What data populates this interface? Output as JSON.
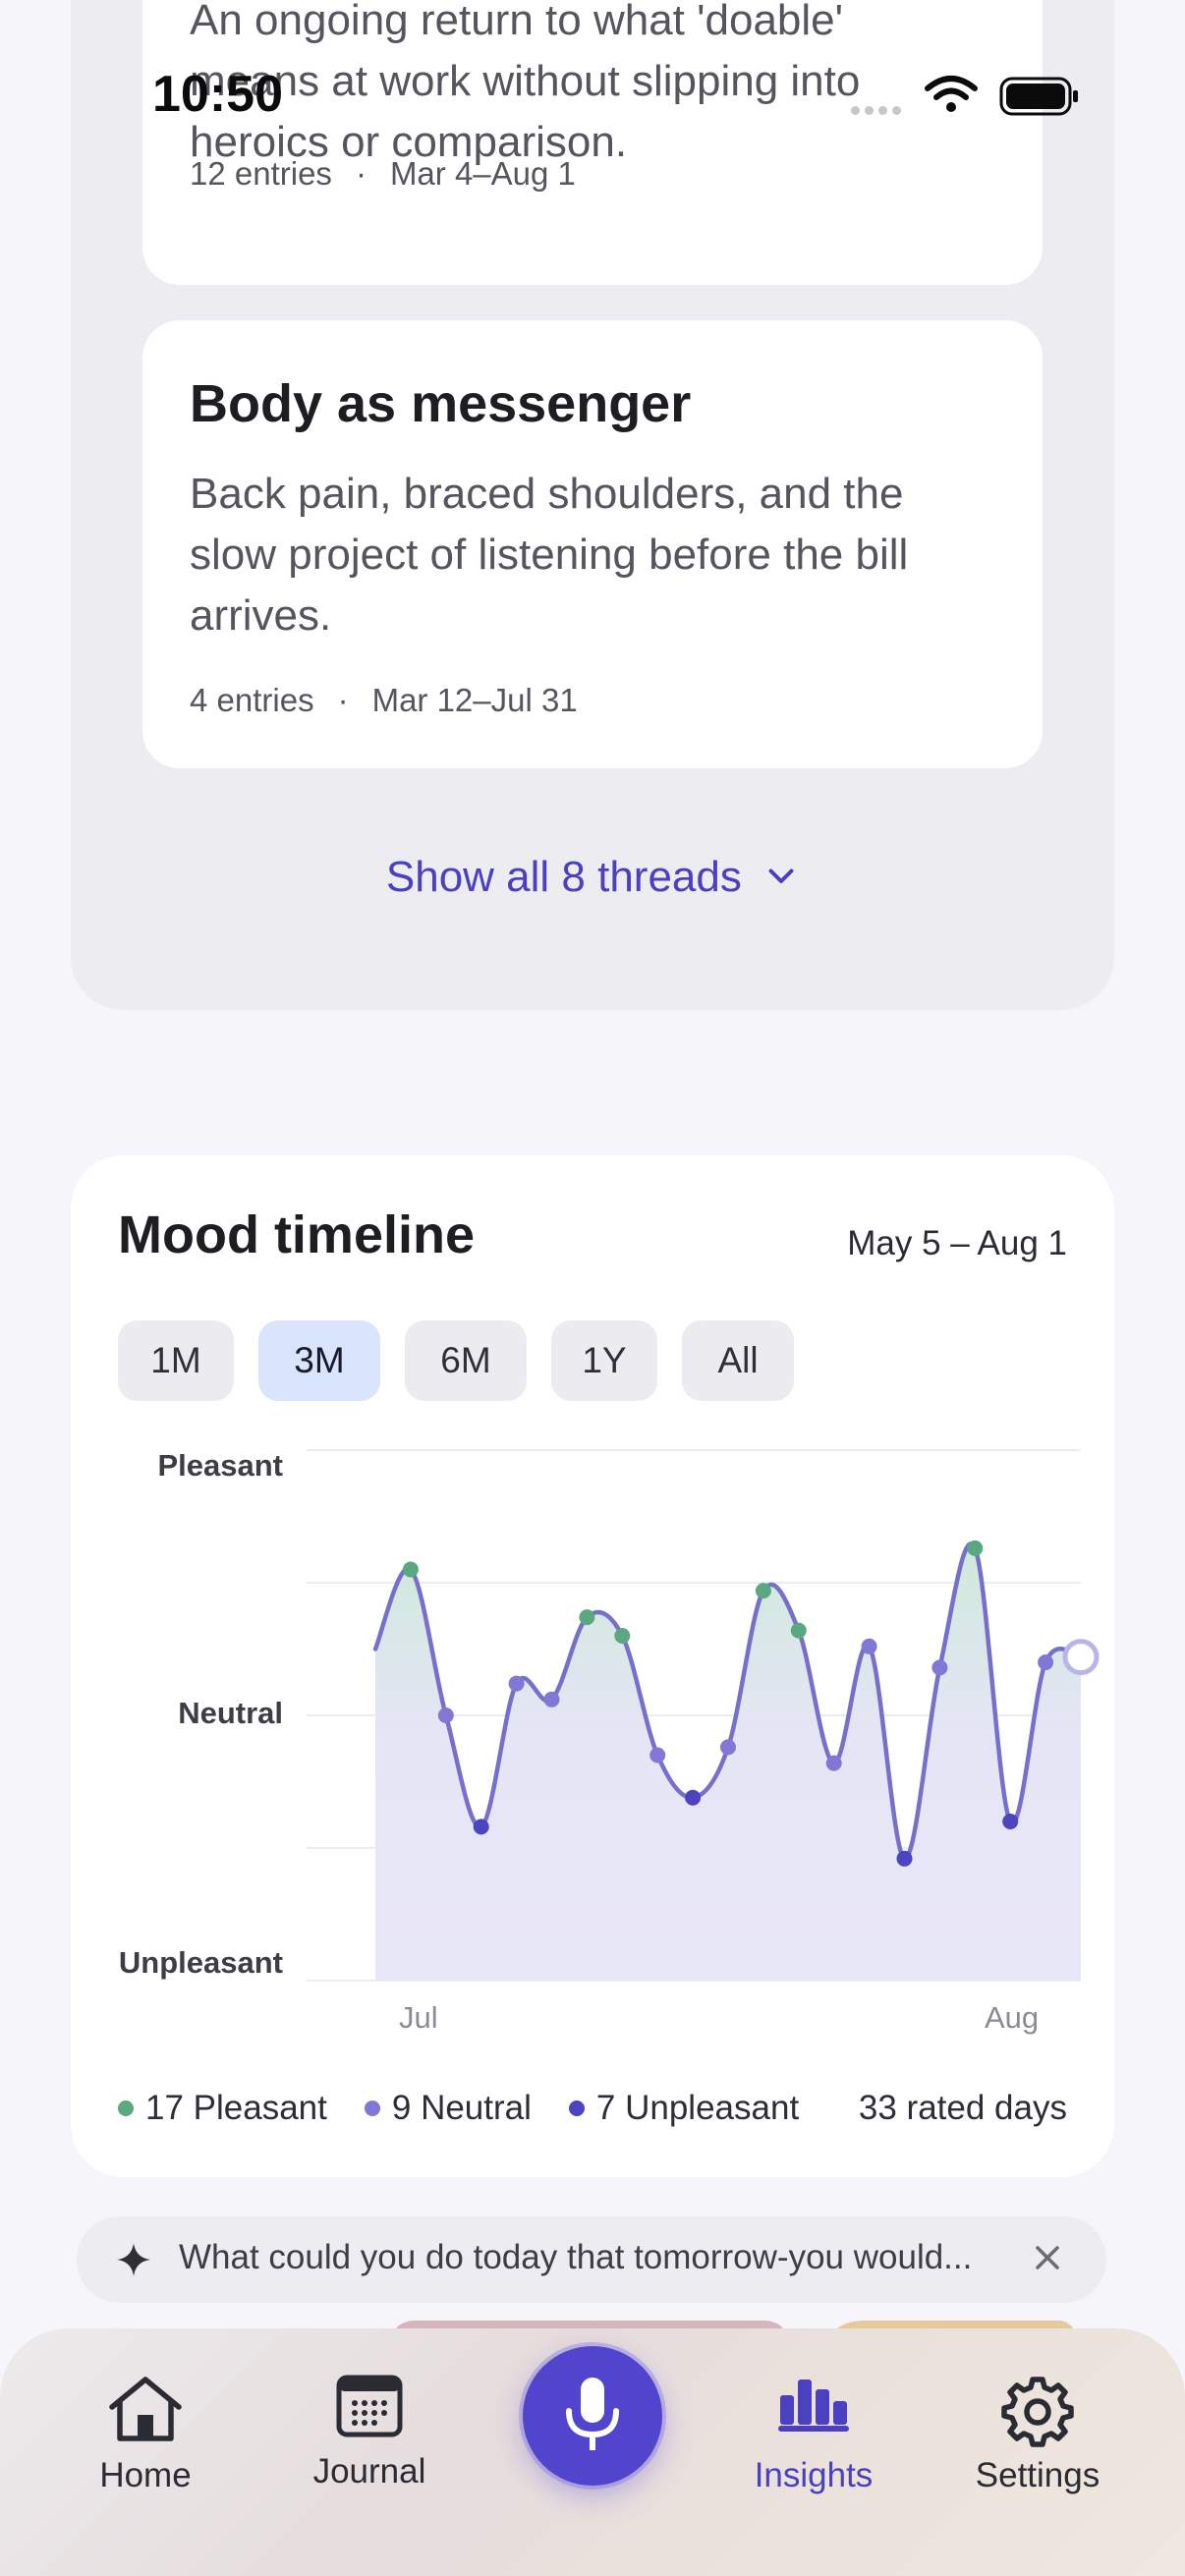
{
  "status_bar": {
    "time": "10:50"
  },
  "threads": {
    "cards": [
      {
        "description": "An ongoing return to what 'doable' means at work without slipping into heroics or comparison.",
        "entries": "12 entries",
        "dates": "Mar 4–Aug 1"
      },
      {
        "title": "Body as messenger",
        "description": "Back pain, braced shoulders, and the slow project of listening before the bill arrives.",
        "entries": "4 entries",
        "dates": "Mar 12–Jul 31"
      }
    ],
    "show_all_label": "Show all 8 threads"
  },
  "mood_timeline": {
    "title": "Mood timeline",
    "date_range": "May 5 – Aug 1",
    "ranges": [
      "1M",
      "3M",
      "6M",
      "1Y",
      "All"
    ],
    "selected_range": "3M",
    "legend": [
      {
        "label": "17 Pleasant",
        "color": "#5aa882"
      },
      {
        "label": "9 Neutral",
        "color": "#8078d4"
      },
      {
        "label": "7 Unpleasant",
        "color": "#4c44c0"
      }
    ],
    "rated_days": "33 rated days"
  },
  "chart_data": {
    "type": "line",
    "title": "Mood timeline",
    "y_tick_labels": [
      "Pleasant",
      "Neutral",
      "Unpleasant"
    ],
    "x_tick_labels": [
      "Jul",
      "Aug"
    ],
    "ylim": [
      -1,
      1
    ],
    "series": [
      {
        "values": [
          0.25,
          0.55,
          0.0,
          -0.42,
          0.12,
          0.06,
          0.37,
          0.3,
          -0.15,
          -0.31,
          -0.12,
          0.47,
          0.32,
          -0.18,
          0.26,
          -0.54,
          0.18,
          0.63,
          -0.4,
          0.2,
          0.22
        ]
      }
    ],
    "colors": {
      "pleasant": "#5aa882",
      "neutral": "#8078d4",
      "unpleasant": "#4c44c0",
      "line": "#7670cc"
    }
  },
  "prompt": {
    "text": "What could you do today that tomorrow-you would..."
  },
  "tab_bar": {
    "items": [
      {
        "label": "Home",
        "icon": "house-icon"
      },
      {
        "label": "Journal",
        "icon": "calendar-icon"
      },
      {
        "label": "Insights",
        "icon": "bar-chart-icon"
      },
      {
        "label": "Settings",
        "icon": "gear-icon"
      }
    ],
    "active": "Insights",
    "record_icon": "microphone-icon",
    "accent": "#4a40c0"
  }
}
